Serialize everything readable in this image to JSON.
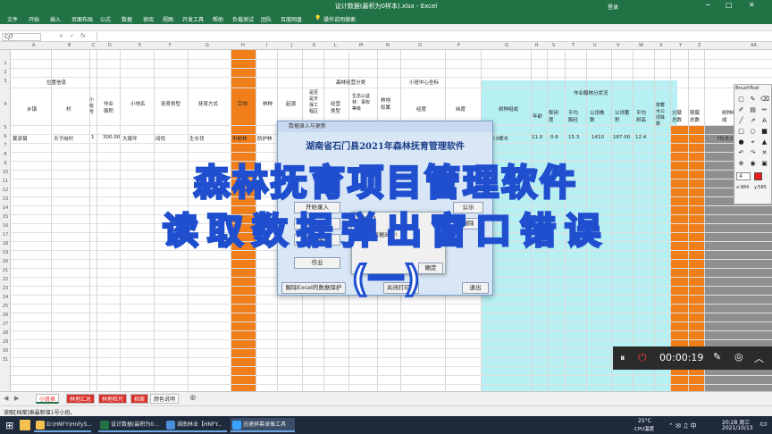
{
  "window": {
    "title": "设计数据(最积为0样本).xlsx - Excel",
    "sign_in": "登录"
  },
  "ribbon_tabs": [
    "文件",
    "开始",
    "插入",
    "页面布局",
    "公式",
    "数据",
    "审阅",
    "视图",
    "开发工具",
    "帮助",
    "负载测试",
    "团队",
    "百度网盘",
    "操作说明搜索"
  ],
  "name_box": "CJ7",
  "formula_icons": [
    "×",
    "✓",
    "fx"
  ],
  "columns": [
    "A",
    "B",
    "C",
    "D",
    "E",
    "F",
    "G",
    "H",
    "I",
    "J",
    "K",
    "L",
    "M",
    "N",
    "O",
    "P",
    "Q",
    "R",
    "S",
    "T",
    "U",
    "V",
    "W",
    "X",
    "Y",
    "Z",
    "AA"
  ],
  "rows": [
    "1",
    "2",
    "3",
    "4",
    "5",
    "6",
    "7",
    "8",
    "9",
    "10",
    "11",
    "12",
    "13",
    "14",
    "15",
    "16",
    "17",
    "18",
    "19",
    "20",
    "21",
    "22",
    "23",
    "24",
    "25",
    "26",
    "27",
    "28",
    "29",
    "30",
    "31"
  ],
  "group_headers": {
    "location": "位置信息",
    "forest_subject": "森林经营分类",
    "center_coord": "小班中心坐标",
    "stand": "作业解林分状况"
  },
  "headers": [
    "乡镇",
    "村",
    "小班号",
    "作业面积",
    "小地名",
    "抚育类型",
    "抚育方式",
    "宗地",
    "林种",
    "起源",
    "是否是天保工程区",
    "经营类型",
    "生态公益林：事权等级",
    "林地权属",
    "经度",
    "纬度",
    "树种组成",
    "年龄",
    "郁闭度",
    "平均胸径",
    "公顷株数",
    "公顷蓄积",
    "平均树高",
    "按蓄木公顷株数",
    "分蘖总数",
    "萌蘖总数",
    "树种组成"
  ],
  "row6": [
    "蒙彦镇",
    "天子岗村",
    "1",
    "300.00",
    "大旗坪",
    "间伐",
    "生长伐",
    "中龄林",
    "防护林",
    "",
    "",
    "",
    "",
    "",
    "",
    "",
    "7杉木3樟木",
    "11.0",
    "0.8",
    "15.3",
    "1410",
    "187.00",
    "12.4",
    "",
    "",
    "",
    "7杉木3"
  ],
  "sheet_tabs": [
    "小班表",
    "林地汇总",
    "林地检尺",
    "档案",
    "颜色说明"
  ],
  "status_text": "读取[档案]表最新增1号小班。",
  "dialog": {
    "title": "数据录入与更新",
    "heading": "湖南省石门县2021年森林抚育管理软件",
    "buttons": [
      "开始录入",
      "数据查询",
      "重新建立",
      "作业"
    ],
    "right_buttons": [
      "公示",
      "删除"
    ],
    "bottom_left": "解除Excel的数据保护",
    "bottom_mid": "关闭打印表",
    "exit": "退出",
    "confirm": "确定"
  },
  "alert": {
    "title": "【提示】",
    "message": "读取数据出错!",
    "ok": "确定"
  },
  "overlay": {
    "line1": "森林抚育项目管理软件",
    "line2": "读取数据弹出窗口错误",
    "line3": "(一)"
  },
  "brush_tool": {
    "title": "BrushTool",
    "size": "4",
    "coords_x": "x:984",
    "coords_y": "y:585"
  },
  "recorder": {
    "time": "00:00:19"
  },
  "taskbar": {
    "items": [
      "D:\\HNFY\\HnFyS...",
      "设计数据(最积为0...",
      "湖南林业【HNFY...",
      "迅捷屏幕录像工具"
    ],
    "weather": "25°C",
    "weather_sub": "CPU温度",
    "time": "20:28 周三",
    "date": "2021/10/13"
  },
  "colors": {
    "excel_green": "#217346",
    "orange_col": "#f07f1b",
    "cyan_col": "#b7f0f3",
    "overlay_stroke": "#1f4fcf"
  }
}
